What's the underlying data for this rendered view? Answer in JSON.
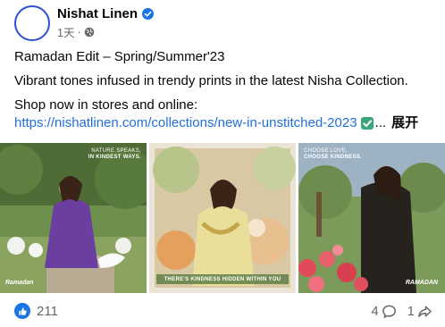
{
  "post": {
    "author": "Nishat Linen",
    "time": "1天",
    "separator": "·",
    "title_line": "Ramadan Edit – Spring/Summer'23",
    "description": "Vibrant tones infused in trendy prints in the latest Nisha Collection.",
    "shop_line": "Shop now in stores and online:",
    "link": "https://nishatlinen.com/collections/new-in-unstitched-2023",
    "ellipsis": "...",
    "see_more": "展开"
  },
  "photos": [
    {
      "caption_line1": "NATURE SPEAKS,",
      "caption_line2": "IN KINDEST WAYS.",
      "brand": "Ramadan"
    },
    {
      "banner": "THERE'S KINDNESS HIDDEN WITHIN YOU"
    },
    {
      "caption_line1": "CHOOSE LOVE,",
      "caption_line2": "CHOOSE KINDNESS.",
      "brand": "RAMADAN"
    }
  ],
  "engagement": {
    "reactions": "211",
    "comments": "4",
    "shares": "1"
  },
  "colors": {
    "link": "#216fdb",
    "verified": "#1b74e4",
    "like": "#1b74e4",
    "avatar_ring": "#2d4fd6",
    "check_emoji": "#3aa57a"
  },
  "icons": {
    "verified": "verified-badge-icon",
    "globe": "globe-icon",
    "check": "check-mark-emoji-icon",
    "like": "thumbs-up-icon",
    "comment": "comment-icon",
    "share": "share-icon"
  }
}
